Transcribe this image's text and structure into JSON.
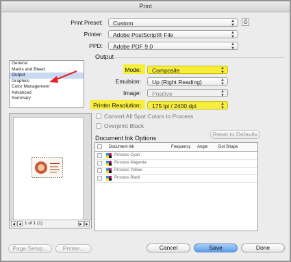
{
  "window": {
    "title": "Print"
  },
  "top": {
    "print_preset": {
      "label": "Print Preset:",
      "value": "Custom"
    },
    "printer": {
      "label": "Printer:",
      "value": "Adobe PostScript® File"
    },
    "ppd": {
      "label": "PPD:",
      "value": "Adobe PDF 9.0"
    }
  },
  "categories": [
    "General",
    "Marks and Bleed",
    "Output",
    "Graphics",
    "Color Management",
    "Advanced",
    "Summary"
  ],
  "selected_category": "Output",
  "output": {
    "heading": "Output",
    "mode": {
      "label": "Mode:",
      "value": "Composite"
    },
    "emulsion": {
      "label": "Emulsion:",
      "value": "Up (Right Reading)"
    },
    "image": {
      "label": "Image:",
      "value": "Positive"
    },
    "printer_resolution": {
      "label": "Printer Resolution:",
      "value": "175 lpi / 2400 dpi"
    },
    "convert_spot": "Convert All Spot Colors to Process",
    "overprint_black": "Overprint Black",
    "reset_button": "Reset to Defaults"
  },
  "ink_options": {
    "heading": "Document Ink Options",
    "columns": [
      "Document Ink",
      "Frequency",
      "Angle",
      "Dot Shape"
    ],
    "inks": [
      "Process Cyan",
      "Process Magenta",
      "Process Yellow",
      "Process Black"
    ]
  },
  "preview": {
    "page_indicator": "1 of 1 (1)"
  },
  "buttons": {
    "page_setup": "Page Setup...",
    "printer": "Printer...",
    "cancel": "Cancel",
    "save": "Save",
    "done": "Done"
  },
  "colors": {
    "highlight": "#f7ee3c",
    "arrow": "#e8202a",
    "primary_button": "#5e9ee8"
  }
}
